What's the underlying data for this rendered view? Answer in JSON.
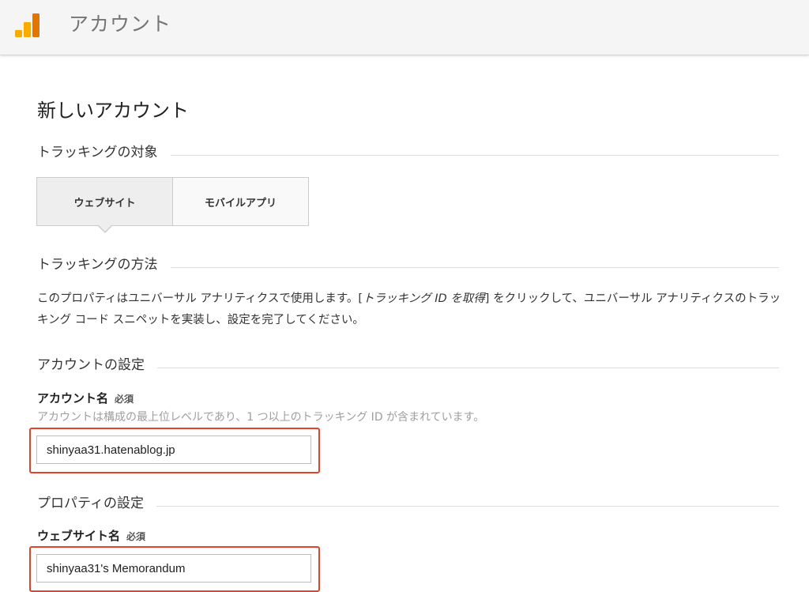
{
  "header": {
    "title": "アカウント",
    "logo_icon": "analytics-logo-icon",
    "logo_colors": [
      "#F9AB00",
      "#F9AB00",
      "#E37400"
    ]
  },
  "page": {
    "title": "新しいアカウント"
  },
  "tracking_target": {
    "heading": "トラッキングの対象",
    "tabs": [
      {
        "label": "ウェブサイト",
        "selected": true
      },
      {
        "label": "モバイルアプリ",
        "selected": false
      }
    ]
  },
  "tracking_method": {
    "heading": "トラッキングの方法",
    "desc_before": "このプロパティはユニバーサル アナリティクスで使用します。[",
    "desc_link": "トラッキング ID を取得",
    "desc_after": "] をクリックして、ユニバーサル アナリティクスのトラッキング コード スニペットを実装し、設定を完了してください。"
  },
  "account_settings": {
    "heading": "アカウントの設定",
    "field_label": "アカウント名",
    "required": "必須",
    "help": "アカウントは構成の最上位レベルであり、1 つ以上のトラッキング ID が含まれています。",
    "value": "shinyaa31.hatenablog.jp"
  },
  "property_settings": {
    "heading": "プロパティの設定",
    "field_label": "ウェブサイト名",
    "required": "必須",
    "value": "shinyaa31's Memorandum"
  },
  "colors": {
    "highlight": "#E8412A",
    "header_bg": "#F5F5F5"
  }
}
